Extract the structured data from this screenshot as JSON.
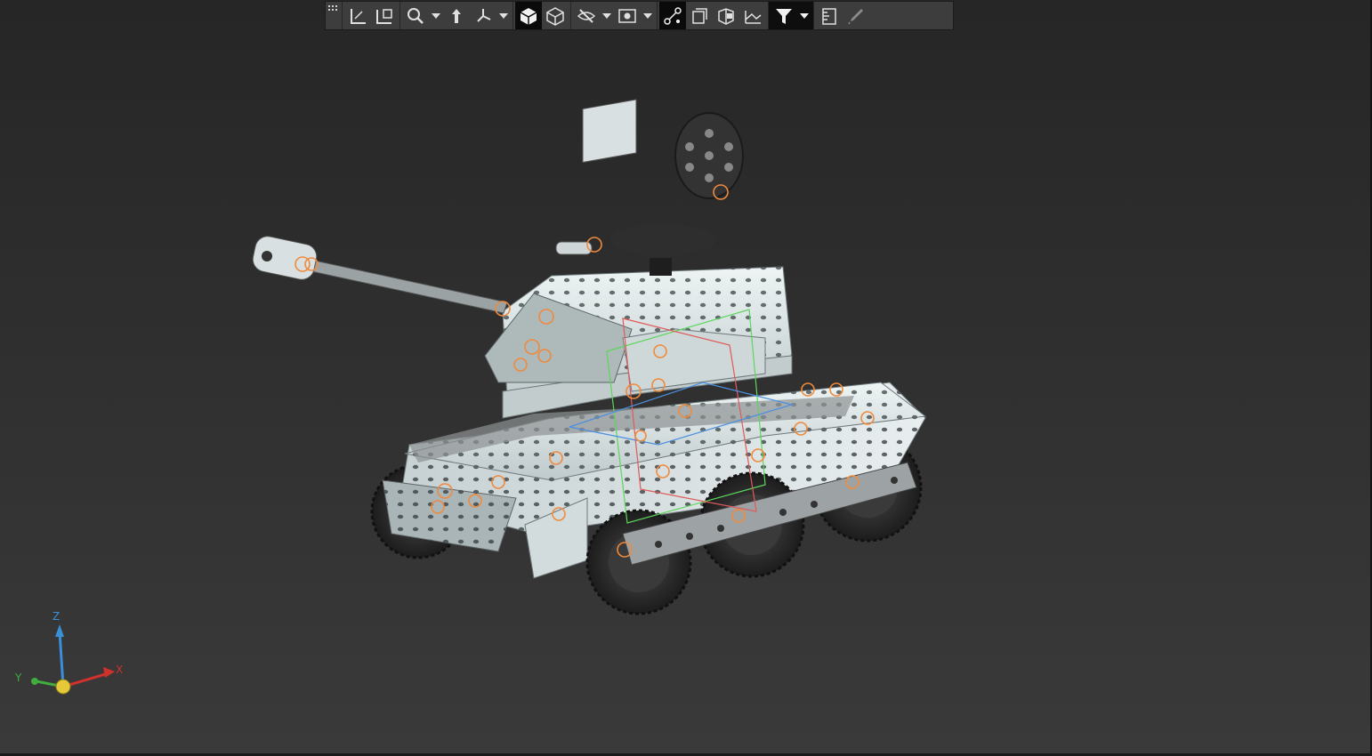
{
  "toolbar": {
    "buttons": [
      {
        "name": "toolbar-grip",
        "icon": "grip-icon"
      },
      {
        "name": "sketch-button",
        "icon": "sketch-plane-icon"
      },
      {
        "name": "view-orientation-button",
        "icon": "view-orientation-icon"
      },
      {
        "name": "zoom-button",
        "icon": "zoom-icon"
      },
      {
        "name": "orient-normal-button",
        "icon": "orient-normal-icon"
      },
      {
        "name": "triad-button",
        "icon": "triad-icon"
      },
      {
        "name": "shaded-display-button",
        "icon": "shaded-cube-icon"
      },
      {
        "name": "wireframe-display-button",
        "icon": "wireframe-cube-icon"
      },
      {
        "name": "hide-button",
        "icon": "eye-slash-icon"
      },
      {
        "name": "show-hidden-button",
        "icon": "eye-box-icon"
      },
      {
        "name": "constraints-button",
        "icon": "constraints-icon"
      },
      {
        "name": "section-view-button",
        "icon": "section-view-icon"
      },
      {
        "name": "exploded-view-button",
        "icon": "exploded-view-icon"
      },
      {
        "name": "ground-plane-button",
        "icon": "ground-plane-icon"
      },
      {
        "name": "selection-filter-button",
        "icon": "filter-icon"
      },
      {
        "name": "measure-button",
        "icon": "measure-icon"
      },
      {
        "name": "appearance-button",
        "icon": "eyedropper-icon"
      }
    ]
  },
  "triad": {
    "x_label": "X",
    "y_label": "Y",
    "z_label": "Z",
    "colors": {
      "x": "#d0312d",
      "y": "#3fae3f",
      "z": "#3a8fd8",
      "origin": "#e6c93a"
    }
  },
  "model": {
    "plate_color": "#dfe7e8",
    "wheel_color": "#2a2a2a",
    "constraint_color": "#f08a3c",
    "box_colors": {
      "green": "#5cd65c",
      "red": "#e05a5a",
      "blue": "#4a8fe0"
    }
  }
}
